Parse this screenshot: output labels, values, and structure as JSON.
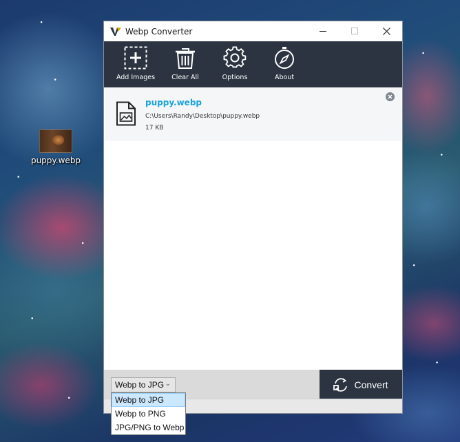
{
  "desktop": {
    "icon_label": "puppy.webp"
  },
  "window": {
    "title": "Webp Converter",
    "controls": {
      "minimize": "—",
      "maximize": "☐",
      "close": "✕"
    }
  },
  "toolbar": {
    "items": [
      {
        "label": "Add Images",
        "icon": "add-image-icon"
      },
      {
        "label": "Clear All",
        "icon": "trash-icon"
      },
      {
        "label": "Options",
        "icon": "gear-icon"
      },
      {
        "label": "About",
        "icon": "compass-icon"
      }
    ]
  },
  "files": [
    {
      "name": "puppy.webp",
      "path": "C:\\Users\\Randy\\Desktop\\puppy.webp",
      "size": "17 KB"
    }
  ],
  "bottom": {
    "format_selected": "Webp to JPG",
    "format_options": [
      "Webp to JPG",
      "Webp to PNG",
      "JPG/PNG to Webp"
    ],
    "convert_label": "Convert"
  },
  "colors": {
    "toolbar_bg": "#2b3440",
    "file_name": "#1aa3dc",
    "dropdown_highlight": "#cce8ff"
  }
}
